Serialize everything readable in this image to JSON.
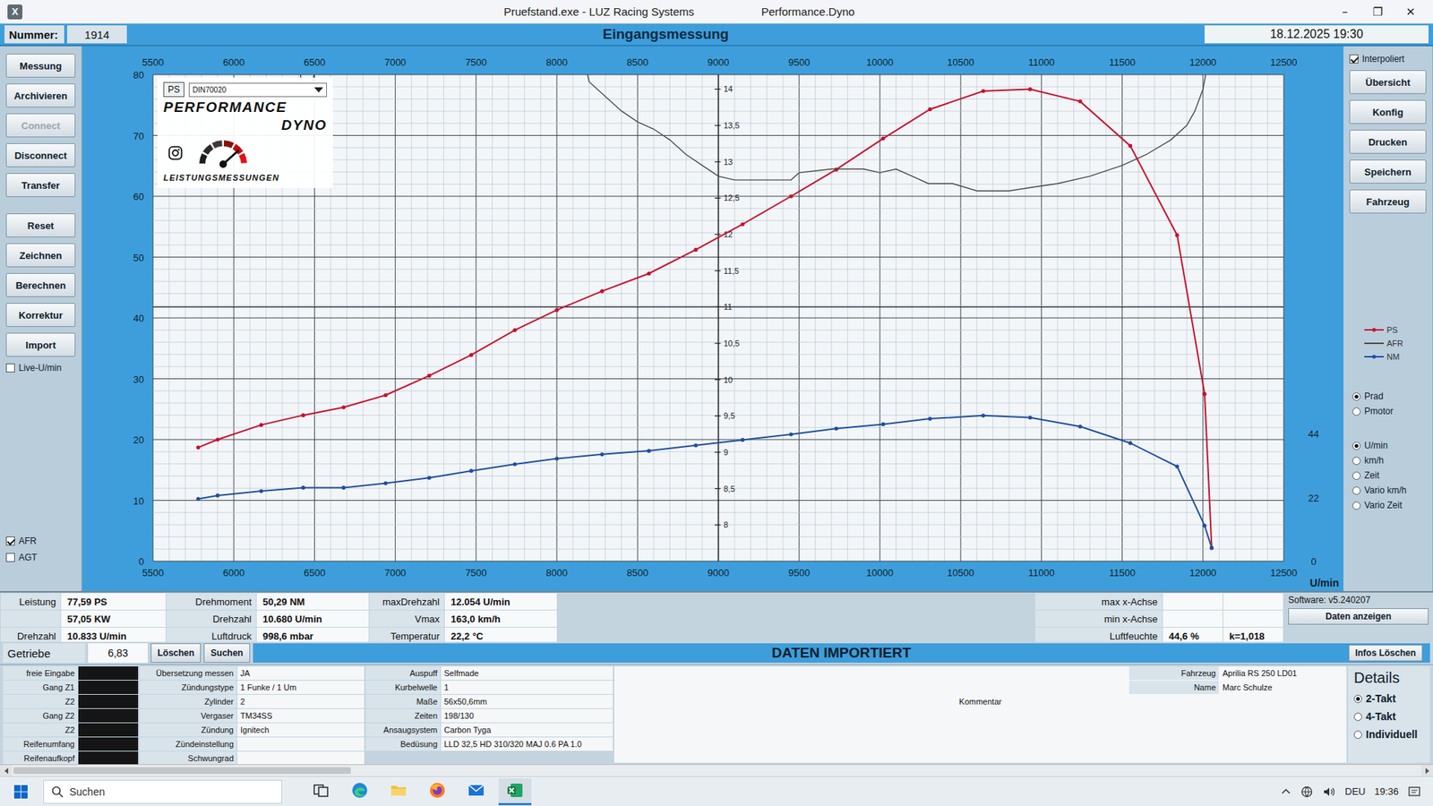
{
  "window": {
    "icon": "X",
    "title": "Pruefstand.exe  -  LUZ Racing Systems",
    "subtitle": "Performance.Dyno",
    "controls": [
      "–",
      "❐",
      "✕"
    ]
  },
  "header": {
    "number_label": "Nummer:",
    "number": "1914",
    "title": "Eingangsmessung",
    "datetime": "18.12.2025 19:30"
  },
  "left_buttons": [
    {
      "label": "Messung",
      "disabled": false
    },
    {
      "label": "Archivieren",
      "disabled": false
    },
    {
      "label": "Connect",
      "disabled": true
    },
    {
      "label": "Disconnect",
      "disabled": false
    },
    {
      "label": "Transfer",
      "disabled": false
    },
    {
      "label": "Reset",
      "disabled": false
    },
    {
      "label": "Zeichnen",
      "disabled": false
    },
    {
      "label": "Berechnen",
      "disabled": false
    },
    {
      "label": "Korrektur",
      "disabled": false
    },
    {
      "label": "Import",
      "disabled": false
    }
  ],
  "left_checks": [
    {
      "label": "Live-U/min",
      "checked": false
    },
    {
      "label": "AFR",
      "checked": true
    },
    {
      "label": "AGT",
      "checked": false
    }
  ],
  "logo": {
    "unit": "PS",
    "norm": "DIN70020",
    "brand_top": "PERFORMANCE",
    "brand_bottom": "DYNO",
    "tagline": "LEISTUNGSMESSUNGEN"
  },
  "chart": {
    "x_ticks": [
      "5500",
      "6000",
      "6500",
      "7000",
      "7500",
      "8000",
      "8500",
      "9000",
      "9500",
      "10000",
      "10500",
      "11000",
      "11500",
      "12000",
      "12500"
    ],
    "y_ticks": [
      "0",
      "10",
      "20",
      "30",
      "40",
      "50",
      "60",
      "70",
      "80"
    ],
    "afr_ticks": [
      "8",
      "8,5",
      "9",
      "9,5",
      "10",
      "10,5",
      "11",
      "11,5",
      "12",
      "12,5",
      "13",
      "13,5",
      "14"
    ],
    "nm_ticks": [
      "44",
      "22",
      "0"
    ],
    "x_unit": "U/min",
    "afr_reference": 11,
    "series": [
      {
        "name": "PS",
        "kind": "power",
        "color": "#c8102e",
        "rpm": [
          5780,
          5900,
          6170,
          6430,
          6680,
          6940,
          7210,
          7470,
          7740,
          8000,
          8280,
          8570,
          8860,
          9150,
          9450,
          9730,
          10020,
          10310,
          10640,
          10930,
          11240,
          11550,
          11840,
          12010,
          12054
        ],
        "values": [
          18.7,
          20.0,
          22.4,
          24.0,
          25.3,
          27.3,
          30.5,
          33.9,
          38.0,
          41.3,
          44.4,
          47.3,
          51.2,
          55.4,
          60.0,
          64.4,
          69.5,
          74.3,
          77.3,
          77.6,
          75.6,
          68.3,
          53.6,
          27.5,
          2.2
        ]
      },
      {
        "name": "AFR",
        "kind": "afr",
        "color": "#4a4a4a",
        "rpm": [
          6380,
          6420,
          6450,
          6490,
          6520,
          8150,
          8200,
          8300,
          8400,
          8500,
          8600,
          8700,
          8800,
          8900,
          9000,
          9100,
          9300,
          9450,
          9500,
          9700,
          9900,
          10000,
          10100,
          10200,
          10300,
          10450,
          10600,
          10800,
          10950,
          11100,
          11300,
          11500,
          11650,
          11800,
          11900,
          11950,
          12000,
          12050
        ],
        "values": [
          14.6,
          14.1,
          13.95,
          14.1,
          14.6,
          14.6,
          14.1,
          13.9,
          13.7,
          13.55,
          13.45,
          13.3,
          13.1,
          12.95,
          12.8,
          12.75,
          12.75,
          12.75,
          12.85,
          12.9,
          12.9,
          12.85,
          12.9,
          12.8,
          12.7,
          12.7,
          12.6,
          12.6,
          12.65,
          12.7,
          12.8,
          12.95,
          13.1,
          13.3,
          13.5,
          13.7,
          14.0,
          14.6
        ]
      },
      {
        "name": "NM",
        "kind": "torque",
        "color": "#1f4fa0",
        "rpm": [
          5780,
          5900,
          6170,
          6430,
          6680,
          6940,
          7210,
          7470,
          7740,
          8000,
          8280,
          8570,
          8860,
          9150,
          9450,
          9730,
          10020,
          10310,
          10640,
          10930,
          11240,
          11550,
          11840,
          12010,
          12054
        ],
        "values": [
          21.5,
          22.7,
          24.2,
          25.4,
          25.4,
          26.9,
          28.8,
          31.2,
          33.5,
          35.4,
          36.9,
          38.1,
          40.0,
          41.9,
          43.8,
          45.8,
          47.3,
          49.2,
          50.3,
          49.6,
          46.5,
          40.8,
          32.7,
          12.3,
          4.6
        ]
      }
    ]
  },
  "right_panel": {
    "interpolated": {
      "label": "Interpoliert",
      "checked": true
    },
    "buttons": [
      "Übersicht",
      "Konfig",
      "Drucken",
      "Speichern",
      "Fahrzeug"
    ],
    "power_mode": [
      {
        "label": "Prad",
        "selected": true
      },
      {
        "label": "Pmotor",
        "selected": false
      }
    ],
    "x_mode": [
      {
        "label": "U/min",
        "selected": true
      },
      {
        "label": "km/h",
        "selected": false
      },
      {
        "label": "Zeit",
        "selected": false
      },
      {
        "label": "Vario km/h",
        "selected": false
      },
      {
        "label": "Vario Zeit",
        "selected": false
      }
    ]
  },
  "results": {
    "rows": [
      {
        "pairs": [
          {
            "label": "Leistung",
            "value": "77,59 PS"
          },
          {
            "label": "Drehmoment",
            "value": "50,29 NM"
          },
          {
            "label": "maxDrehzahl",
            "value": "12.054 U/min"
          },
          {
            "label": "max x-Achse",
            "value": ""
          }
        ],
        "extra": ""
      },
      {
        "pairs": [
          {
            "label": "",
            "value": "57,05 KW"
          },
          {
            "label": "Drehzahl",
            "value": "10.680 U/min"
          },
          {
            "label": "Vmax",
            "value": "163,0 km/h"
          },
          {
            "label": "min x-Achse",
            "value": ""
          }
        ],
        "extra": ""
      },
      {
        "pairs": [
          {
            "label": "Drehzahl",
            "value": "10.833 U/min"
          },
          {
            "label": "Luftdruck",
            "value": "998,6 mbar"
          },
          {
            "label": "Temperatur",
            "value": "22,2 °C"
          },
          {
            "label": "Luftfeuchte",
            "value": "44,6 %"
          }
        ],
        "extra": "k=1,018"
      }
    ],
    "software": "Software: v5.240207",
    "show_button": "Daten anzeigen"
  },
  "gear": {
    "label": "Getriebe",
    "value": "6,83",
    "buttons": [
      "Löschen",
      "Suchen"
    ],
    "banner": "DATEN IMPORTIERT",
    "info_button": "Infos Löschen"
  },
  "info": {
    "gear_fields": [
      {
        "label": "freie Eingabe",
        "value": ""
      },
      {
        "label": "Gang Z1",
        "value": ""
      },
      {
        "label": "Z2",
        "value": ""
      },
      {
        "label": "Gang Z2",
        "value": ""
      },
      {
        "label": "Z2",
        "value": ""
      },
      {
        "label": "Reifenumfang",
        "value": ""
      },
      {
        "label": "Reifenaufkopf",
        "value": ""
      }
    ],
    "setup_fields": [
      {
        "label": "Übersetzung messen",
        "value": "JA"
      },
      {
        "label": "Zündungstype",
        "value": "1 Funke / 1 Um"
      },
      {
        "label": "Zylinder",
        "value": "2"
      },
      {
        "label": "Vergaser",
        "value": "TM34SS"
      },
      {
        "label": "Zündung",
        "value": "Ignitech"
      },
      {
        "label": "Zündeinstellung",
        "value": ""
      },
      {
        "label": "Schwungrad",
        "value": ""
      }
    ],
    "engine_fields": [
      {
        "label": "Auspuff",
        "value": "Selfmade"
      },
      {
        "label": "Kurbelwelle",
        "value": "1"
      },
      {
        "label": "Maße",
        "value": "56x50,6mm"
      },
      {
        "label": "Zeiten",
        "value": "198/130"
      },
      {
        "label": "Ansaugsystem",
        "value": "Carbon Tyga"
      },
      {
        "label": "Bedüsung",
        "value": "LLD 32,5 HD 310/320 MAJ 0.6 PA 1.0"
      }
    ],
    "vehicle_fields": [
      {
        "label": "Fahrzeug",
        "value": "Aprilia RS 250 LD01"
      },
      {
        "label": "Name",
        "value": "Marc Schulze"
      }
    ],
    "comment_label": "Kommentar",
    "details": {
      "title": "Details",
      "options": [
        {
          "label": "2-Takt",
          "selected": true
        },
        {
          "label": "4-Takt",
          "selected": false
        },
        {
          "label": "Individuell",
          "selected": false
        }
      ]
    }
  },
  "scrollbar": {
    "level": 0.24
  },
  "taskbar": {
    "search": "Suchen",
    "apps": [
      {
        "kind": "taskview",
        "active": false
      },
      {
        "kind": "edge",
        "active": false
      },
      {
        "kind": "explorer",
        "active": false
      },
      {
        "kind": "firefox",
        "active": false
      },
      {
        "kind": "mail",
        "active": false
      },
      {
        "kind": "excel",
        "active": true
      }
    ],
    "language": "DEU",
    "time": "19:36"
  }
}
